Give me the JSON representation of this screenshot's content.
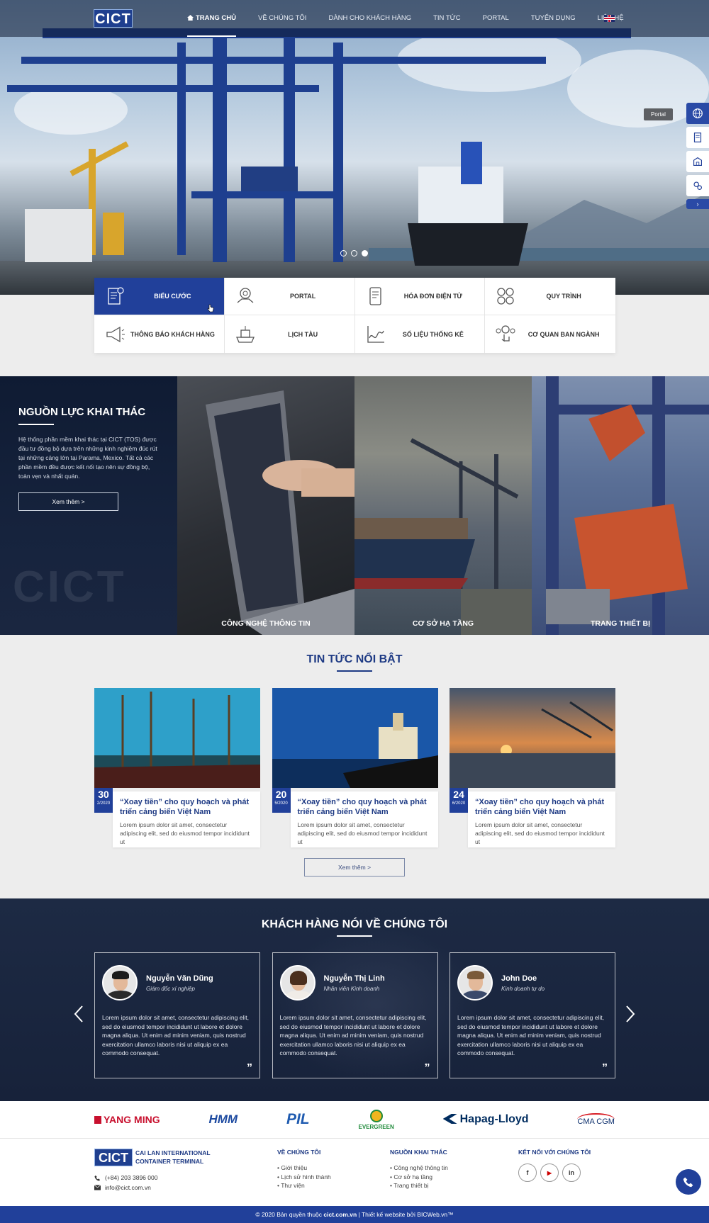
{
  "nav": {
    "logo": "CICT",
    "items": [
      {
        "label": "TRANG CHỦ",
        "active": true
      },
      {
        "label": "VỀ CHÚNG TÔI"
      },
      {
        "label": "DÀNH CHO KHÁCH HÀNG"
      },
      {
        "label": "TIN TỨC"
      },
      {
        "label": "PORTAL"
      },
      {
        "label": "TUYỂN DỤNG"
      },
      {
        "label": "LIÊN HỆ"
      }
    ],
    "language_icon": "uk-flag-icon"
  },
  "hero": {
    "slider_dots": 3,
    "active_dot": 3,
    "side_tooltip": "Portal",
    "side_icons": [
      "globe-icon",
      "document-icon",
      "building-icon",
      "gears-icon"
    ]
  },
  "services": [
    {
      "label": "BIỂU CƯỚC",
      "icon": "invoice-icon",
      "active": true
    },
    {
      "label": "PORTAL",
      "icon": "handshake-gear-icon"
    },
    {
      "label": "HÓA ĐƠN ĐIỆN TỬ",
      "icon": "tablet-invoice-icon"
    },
    {
      "label": "QUY TRÌNH",
      "icon": "process-gears-icon"
    },
    {
      "label": "THÔNG BÁO KHÁCH HÀNG",
      "icon": "megaphone-icon"
    },
    {
      "label": "LỊCH TÀU",
      "icon": "ship-icon"
    },
    {
      "label": "SỐ LIỆU THỐNG KÊ",
      "icon": "chart-icon"
    },
    {
      "label": "CƠ QUAN BAN NGÀNH",
      "icon": "touch-network-icon"
    }
  ],
  "resources": {
    "title": "NGUỒN LỰC KHAI THÁC",
    "text": "Hệ thống phần mềm khai thác tại CICT (TOS) được đầu tư đồng bộ dựa trên những kinh nghiệm đúc rút tại những cảng lớn tại Parama, Mexico. Tất cả các phần mềm đều được kết nối tạo nên sự đồng bộ, toàn vẹn và nhất quán.",
    "button": "Xem thêm >",
    "watermark": "CICT",
    "cards": [
      "CÔNG NGHỆ THÔNG TIN",
      "CƠ SỞ HẠ TẦNG",
      "TRANG THIẾT BỊ"
    ]
  },
  "news": {
    "title": "TIN TỨC NỔI BẬT",
    "items": [
      {
        "day": "30",
        "month": "2/2020",
        "title": "“Xoay tiền” cho quy hoạch và phát triển cảng biển Việt Nam",
        "excerpt": "Lorem ipsum dolor sit amet, consectetur adipiscing elit, sed do eiusmod tempor incididunt ut"
      },
      {
        "day": "20",
        "month": "5/2020",
        "title": "“Xoay tiền” cho quy hoạch và phát triển cảng biển Việt Nam",
        "excerpt": "Lorem ipsum dolor sit amet, consectetur adipiscing elit, sed do eiusmod tempor incididunt ut"
      },
      {
        "day": "24",
        "month": "6/2020",
        "title": "“Xoay tiền” cho quy hoạch và phát triển cảng biển Việt Nam",
        "excerpt": "Lorem ipsum dolor sit amet, consectetur adipiscing elit, sed do eiusmod tempor incididunt ut"
      }
    ],
    "more": "Xem thêm >"
  },
  "testimonials": {
    "title": "KHÁCH HÀNG NÓI VỀ CHÚNG TÔI",
    "items": [
      {
        "name": "Nguyễn Văn Dũng",
        "role": "Giám đốc xí nghiệp",
        "text": "Lorem ipsum dolor sit amet, consectetur adipiscing elit, sed do eiusmod tempor incididunt ut labore et dolore magna aliqua. Ut enim ad minim veniam, quis nostrud exercitation ullamco laboris nisi ut aliquip ex ea commodo consequat."
      },
      {
        "name": "Nguyễn Thị Linh",
        "role": "Nhân viên Kinh doanh",
        "text": "Lorem ipsum dolor sit amet, consectetur adipiscing elit, sed do eiusmod tempor incididunt ut labore et dolore magna aliqua. Ut enim ad minim veniam, quis nostrud exercitation ullamco laboris nisi ut aliquip ex ea commodo consequat."
      },
      {
        "name": "John Doe",
        "role": "Kinh doanh tự do",
        "text": "Lorem ipsum dolor sit amet, consectetur adipiscing elit, sed do eiusmod tempor incididunt ut labore et dolore magna aliqua. Ut enim ad minim veniam, quis nostrud exercitation ullamco laboris nisi ut aliquip ex ea commodo consequat."
      }
    ],
    "quote_mark": "”"
  },
  "partners": [
    "YANG MING",
    "HMM",
    "PIL",
    "EVERGREEN",
    "Hapag-Lloyd",
    "CMA CGM"
  ],
  "footer": {
    "logo": "CICT",
    "company_line1": "CAI LAN INTERNATIONAL",
    "company_line2": "CONTAINER TERMINAL",
    "phone": "(+84) 203 3896 000",
    "email": "info@cict.com.vn",
    "about_title": "VỀ CHÚNG TÔI",
    "about_items": [
      "Giới thiệu",
      "Lịch sử hình thành",
      "Thư viện"
    ],
    "resources_title": "NGUỒN KHAI THÁC",
    "resources_items": [
      "Công nghệ thông tin",
      "Cơ sở hạ tầng",
      "Trang thiết bị"
    ],
    "social_title": "KẾT NỐI VỚI CHÚNG TÔI",
    "social": [
      "f",
      "▶",
      "in"
    ],
    "copyright_prefix": "© 2020 Bản quyền thuộc",
    "copyright_site": "cict.com.vn",
    "copyright_suffix": "| Thiết kế website bởi BICWeb.vn™"
  },
  "colors": {
    "brand": "#21409a",
    "dark": "#17223a",
    "accent_text": "#1e3a84"
  }
}
